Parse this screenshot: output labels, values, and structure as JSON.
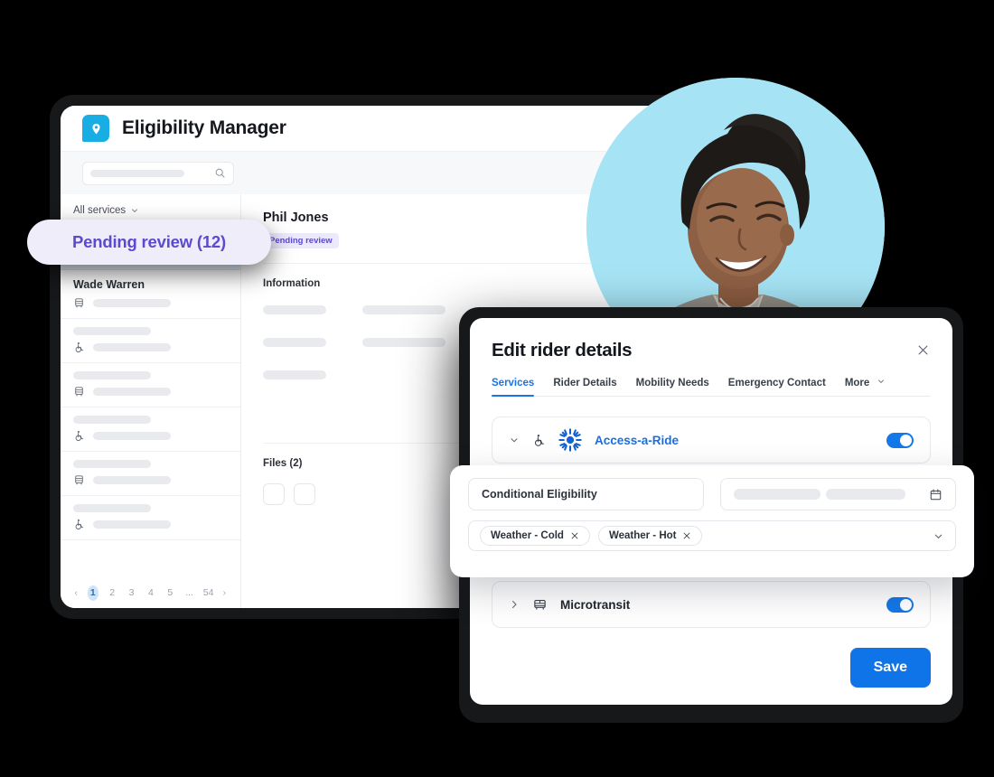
{
  "app": {
    "title": "Eligibility Manager",
    "logo_icon": "map-pin-icon",
    "logo_color": "#19AEE3"
  },
  "toolbar": {
    "search_placeholder": "",
    "search_icon": "search-icon"
  },
  "sidebar": {
    "filter_label": "All services",
    "filter_icon": "chevron-down-icon",
    "rows": [
      {
        "name": "",
        "icon": "wheelchair-icon",
        "selected": true
      },
      {
        "name": "Wade Warren",
        "icon": "bus-icon",
        "selected": false
      },
      {
        "name": "",
        "icon": "wheelchair-icon",
        "selected": false
      },
      {
        "name": "",
        "icon": "bus-icon",
        "selected": false
      },
      {
        "name": "",
        "icon": "wheelchair-icon",
        "selected": false
      },
      {
        "name": "",
        "icon": "bus-icon",
        "selected": false
      },
      {
        "name": "",
        "icon": "wheelchair-icon",
        "selected": false
      }
    ],
    "pagination": {
      "prev_icon": "chevron-left-icon",
      "next_icon": "chevron-right-icon",
      "pages": [
        "1",
        "2",
        "3",
        "4",
        "5",
        "...",
        "54"
      ],
      "active_page": "1"
    }
  },
  "detail": {
    "rider_name": "Phil Jones",
    "status_badge": "Pending review",
    "information_heading": "Information",
    "files_heading": "Files (2)"
  },
  "callout": {
    "label": "Pending review (12)",
    "bg_color": "#f0edfb",
    "text_color": "#5b4ad0"
  },
  "photo": {
    "alt": "smiling-woman-portrait",
    "bg_color": "#A6E4F5"
  },
  "modal": {
    "title": "Edit rider details",
    "close_icon": "close-icon",
    "tabs": [
      {
        "label": "Services",
        "active": true
      },
      {
        "label": "Rider Details",
        "active": false
      },
      {
        "label": "Mobility Needs",
        "active": false
      },
      {
        "label": "Emergency Contact",
        "active": false
      },
      {
        "label": "More",
        "active": false,
        "icon": "chevron-down-icon"
      }
    ],
    "services": [
      {
        "name": "Access-a-Ride",
        "expand_icon": "chevron-down-icon",
        "service_icon": "wheelchair-icon",
        "brand_icon": "sunburst-icon",
        "enabled": true
      },
      {
        "name": "Microtransit",
        "expand_icon": "chevron-right-icon",
        "service_icon": "shuttle-bus-icon",
        "enabled": true
      }
    ],
    "save_label": "Save",
    "save_color": "#0e74e8"
  },
  "conditional_card": {
    "eligibility_value": "Conditional Eligibility",
    "date_icon": "calendar-icon",
    "date_value": "",
    "tags": [
      {
        "label": "Weather - Cold",
        "remove_icon": "close-icon"
      },
      {
        "label": "Weather - Hot",
        "remove_icon": "close-icon"
      }
    ],
    "dropdown_icon": "chevron-down-icon"
  }
}
